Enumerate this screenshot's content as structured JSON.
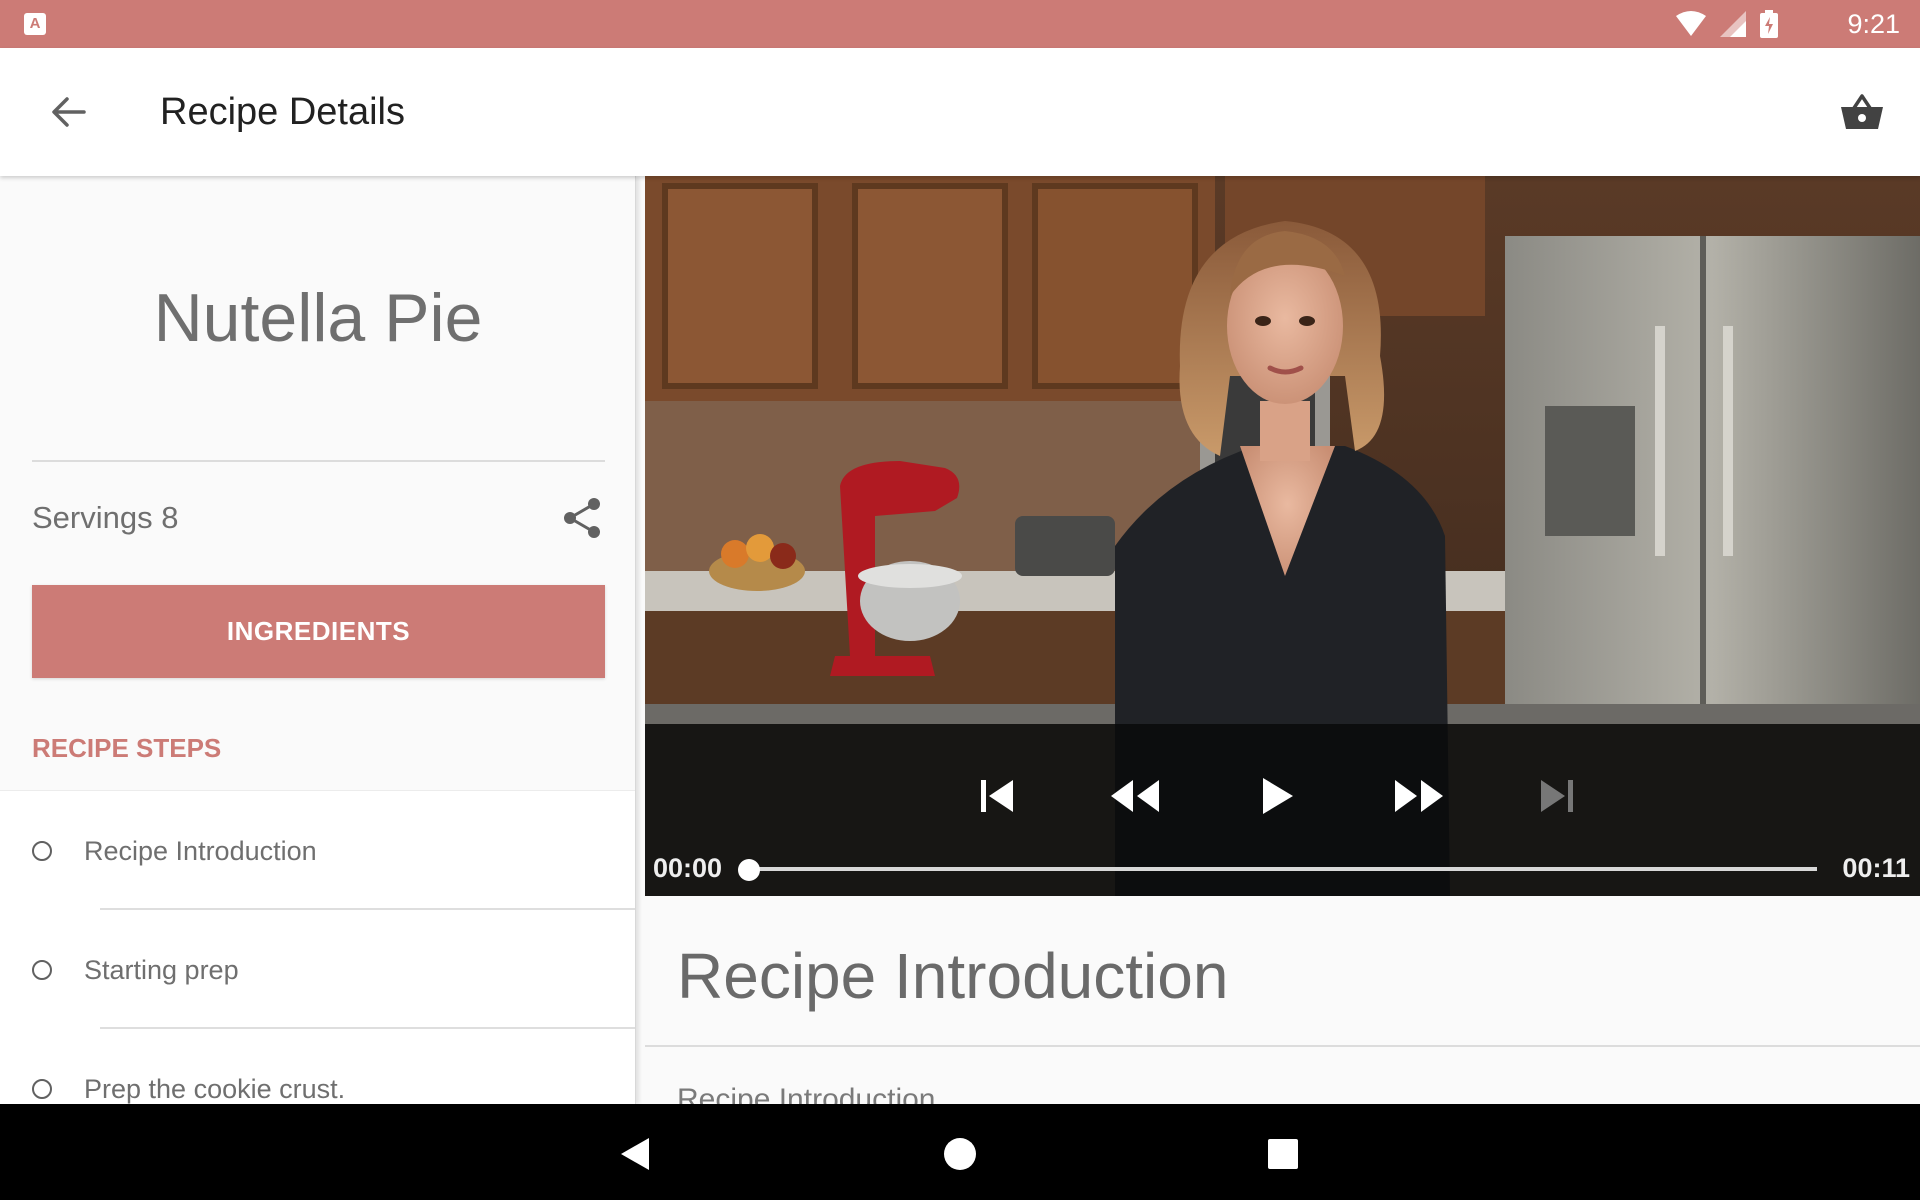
{
  "status_bar": {
    "app_badge": "A",
    "clock": "9:21",
    "icons": [
      "wifi-icon",
      "signal-icon",
      "battery-charging-icon"
    ]
  },
  "app_bar": {
    "title": "Recipe Details",
    "back_icon": "arrow-back-icon",
    "cart_icon": "shopping-basket-icon"
  },
  "recipe": {
    "name": "Nutella Pie",
    "servings": "Servings 8",
    "share_icon": "share-icon",
    "ingredients_button": "INGREDIENTS",
    "steps_header": "RECIPE STEPS",
    "steps": [
      {
        "label": "Recipe Introduction"
      },
      {
        "label": "Starting prep"
      },
      {
        "label": "Prep the cookie crust."
      }
    ]
  },
  "player": {
    "position_time": "00:00",
    "duration_time": "00:11",
    "progress": 0.0,
    "controls": [
      "skip-previous-icon",
      "rewind-icon",
      "play-icon",
      "fast-forward-icon",
      "skip-next-icon"
    ]
  },
  "step_detail": {
    "title": "Recipe Introduction",
    "description": "Recipe Introduction"
  },
  "nav_bar": {
    "icons": [
      "nav-back-icon",
      "nav-home-icon",
      "nav-recents-icon"
    ]
  },
  "colors": {
    "accent": "#cc7b76",
    "status_bar": "#cc7b76",
    "nav_bar": "#000000"
  }
}
